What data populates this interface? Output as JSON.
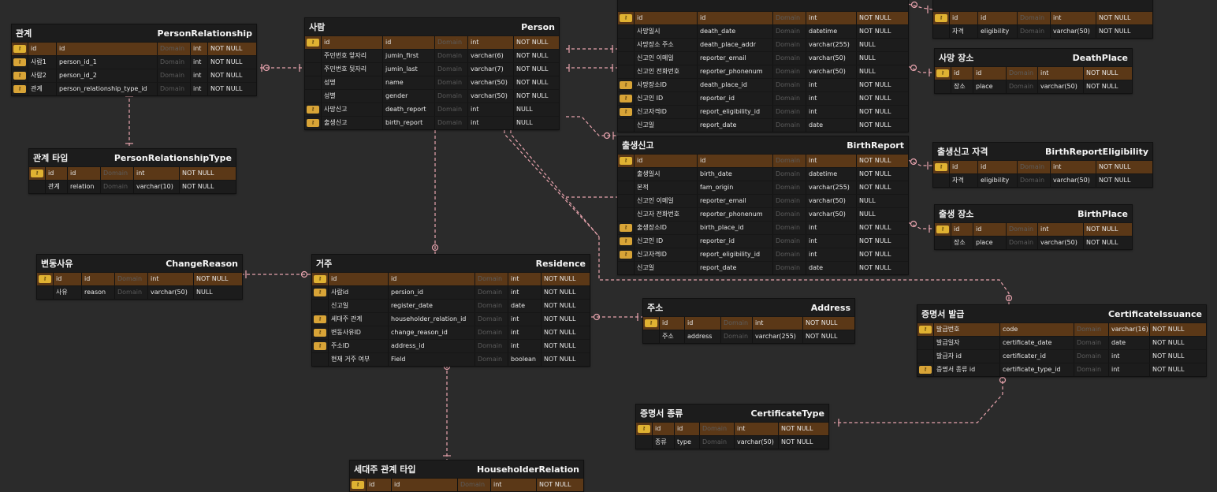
{
  "colors": {
    "canvas": "#2b2b2b",
    "entity_bg": "#1c1c1c",
    "pk_row": "#5b3817",
    "relation_line": "#e7a3ad",
    "key_icon": "#e0b232"
  },
  "key_icon_text": "🔑",
  "entities": [
    {
      "id": "PersonRelationship",
      "logical": "관계",
      "physical": "PersonRelationship",
      "rows": [
        {
          "k": "pk",
          "ln": "id",
          "pn": "id",
          "dm": "Domain",
          "ty": "int",
          "nl": "NOT NULL"
        },
        {
          "k": "fk",
          "ln": "사람1",
          "pn": "person_id_1",
          "dm": "Domain",
          "ty": "int",
          "nl": "NOT NULL"
        },
        {
          "k": "fk",
          "ln": "사람2",
          "pn": "person_id_2",
          "dm": "Domain",
          "ty": "int",
          "nl": "NOT NULL"
        },
        {
          "k": "fk",
          "ln": "관계",
          "pn": "person_relationship_type_id",
          "dm": "Domain",
          "ty": "int",
          "nl": "NOT NULL"
        }
      ]
    },
    {
      "id": "PersonRelationshipType",
      "logical": "관계 타입",
      "physical": "PersonRelationshipType",
      "rows": [
        {
          "k": "pk",
          "ln": "id",
          "pn": "id",
          "dm": "Domain",
          "ty": "int",
          "nl": "NOT NULL"
        },
        {
          "k": "",
          "ln": "관계",
          "pn": "relation",
          "dm": "Domain",
          "ty": "varchar(10)",
          "nl": "NOT NULL"
        }
      ]
    },
    {
      "id": "Person",
      "logical": "사람",
      "physical": "Person",
      "rows": [
        {
          "k": "pk",
          "ln": "id",
          "pn": "id",
          "dm": "Domain",
          "ty": "int",
          "nl": "NOT NULL"
        },
        {
          "k": "",
          "ln": "주민번호 앞자리",
          "pn": "jumin_first",
          "dm": "Domain",
          "ty": "varchar(6)",
          "nl": "NOT NULL"
        },
        {
          "k": "",
          "ln": "주민번호 뒷자리",
          "pn": "jumin_last",
          "dm": "Domain",
          "ty": "varchar(7)",
          "nl": "NOT NULL"
        },
        {
          "k": "",
          "ln": "성명",
          "pn": "name",
          "dm": "Domain",
          "ty": "varchar(50)",
          "nl": "NOT NULL"
        },
        {
          "k": "",
          "ln": "성별",
          "pn": "gender",
          "dm": "Domain",
          "ty": "varchar(50)",
          "nl": "NOT NULL"
        },
        {
          "k": "fk",
          "ln": "사망신고",
          "pn": "death_report",
          "dm": "Domain",
          "ty": "int",
          "nl": "NULL"
        },
        {
          "k": "fk",
          "ln": "출생신고",
          "pn": "birth_report",
          "dm": "Domain",
          "ty": "int",
          "nl": "NULL"
        }
      ]
    },
    {
      "id": "DeathReport",
      "logical": "",
      "physical": "",
      "rows": [
        {
          "k": "pk",
          "ln": "id",
          "pn": "id",
          "dm": "Domain",
          "ty": "int",
          "nl": "NOT NULL"
        },
        {
          "k": "",
          "ln": "사망일시",
          "pn": "death_date",
          "dm": "Domain",
          "ty": "datetime",
          "nl": "NOT NULL"
        },
        {
          "k": "",
          "ln": "사망장소 주소",
          "pn": "death_place_addr",
          "dm": "Domain",
          "ty": "varchar(255)",
          "nl": "NULL"
        },
        {
          "k": "",
          "ln": "신고인 이메일",
          "pn": "reporter_email",
          "dm": "Domain",
          "ty": "varchar(50)",
          "nl": "NULL"
        },
        {
          "k": "",
          "ln": "신고인 전화번호",
          "pn": "reporter_phonenum",
          "dm": "Domain",
          "ty": "varchar(50)",
          "nl": "NULL"
        },
        {
          "k": "fk",
          "ln": "사망장소ID",
          "pn": "death_place_id",
          "dm": "Domain",
          "ty": "int",
          "nl": "NOT NULL"
        },
        {
          "k": "fk",
          "ln": "신고인 ID",
          "pn": "reporter_id",
          "dm": "Domain",
          "ty": "int",
          "nl": "NOT NULL"
        },
        {
          "k": "fk",
          "ln": "신고자격ID",
          "pn": "report_eligibility_id",
          "dm": "Domain",
          "ty": "int",
          "nl": "NOT NULL"
        },
        {
          "k": "",
          "ln": "신고일",
          "pn": "report_date",
          "dm": "Domain",
          "ty": "date",
          "nl": "NOT NULL"
        }
      ]
    },
    {
      "id": "DeathReportEligibility",
      "logical": "",
      "physical": "",
      "rows": [
        {
          "k": "pk",
          "ln": "id",
          "pn": "id",
          "dm": "Domain",
          "ty": "int",
          "nl": "NOT NULL"
        },
        {
          "k": "",
          "ln": "자격",
          "pn": "eligibility",
          "dm": "Domain",
          "ty": "varchar(50)",
          "nl": "NOT NULL"
        }
      ]
    },
    {
      "id": "DeathPlace",
      "logical": "사망 장소",
      "physical": "DeathPlace",
      "rows": [
        {
          "k": "pk",
          "ln": "id",
          "pn": "id",
          "dm": "Domain",
          "ty": "int",
          "nl": "NOT NULL"
        },
        {
          "k": "",
          "ln": "장소",
          "pn": "place",
          "dm": "Domain",
          "ty": "varchar(50)",
          "nl": "NOT NULL"
        }
      ]
    },
    {
      "id": "BirthReport",
      "logical": "출생신고",
      "physical": "BirthReport",
      "rows": [
        {
          "k": "pk",
          "ln": "id",
          "pn": "id",
          "dm": "Domain",
          "ty": "int",
          "nl": "NOT NULL"
        },
        {
          "k": "",
          "ln": "출생일시",
          "pn": "birth_date",
          "dm": "Domain",
          "ty": "datetime",
          "nl": "NOT NULL"
        },
        {
          "k": "",
          "ln": "본적",
          "pn": "fam_origin",
          "dm": "Domain",
          "ty": "varchar(255)",
          "nl": "NOT NULL"
        },
        {
          "k": "",
          "ln": "신고인 이메일",
          "pn": "reporter_email",
          "dm": "Domain",
          "ty": "varchar(50)",
          "nl": "NULL"
        },
        {
          "k": "",
          "ln": "신고자 전화번호",
          "pn": "reporter_phonenum",
          "dm": "Domain",
          "ty": "varchar(50)",
          "nl": "NULL"
        },
        {
          "k": "fk",
          "ln": "출생장소ID",
          "pn": "birth_place_id",
          "dm": "Domain",
          "ty": "int",
          "nl": "NOT NULL"
        },
        {
          "k": "fk",
          "ln": "신고인 ID",
          "pn": "reporter_id",
          "dm": "Domain",
          "ty": "int",
          "nl": "NOT NULL"
        },
        {
          "k": "fk",
          "ln": "신고자격ID",
          "pn": "report_eligibility_id",
          "dm": "Domain",
          "ty": "int",
          "nl": "NOT NULL"
        },
        {
          "k": "",
          "ln": "신고일",
          "pn": "report_date",
          "dm": "Domain",
          "ty": "date",
          "nl": "NOT NULL"
        }
      ]
    },
    {
      "id": "BirthReportEligibility",
      "logical": "출생신고 자격",
      "physical": "BirthReportEligibility",
      "rows": [
        {
          "k": "pk",
          "ln": "id",
          "pn": "id",
          "dm": "Domain",
          "ty": "int",
          "nl": "NOT NULL"
        },
        {
          "k": "",
          "ln": "자격",
          "pn": "eligibility",
          "dm": "Domain",
          "ty": "varchar(50)",
          "nl": "NOT NULL"
        }
      ]
    },
    {
      "id": "BirthPlace",
      "logical": "출생 장소",
      "physical": "BirthPlace",
      "rows": [
        {
          "k": "pk",
          "ln": "id",
          "pn": "id",
          "dm": "Domain",
          "ty": "int",
          "nl": "NOT NULL"
        },
        {
          "k": "",
          "ln": "장소",
          "pn": "place",
          "dm": "Domain",
          "ty": "varchar(50)",
          "nl": "NOT NULL"
        }
      ]
    },
    {
      "id": "ChangeReason",
      "logical": "변동사유",
      "physical": "ChangeReason",
      "rows": [
        {
          "k": "pk",
          "ln": "id",
          "pn": "id",
          "dm": "Domain",
          "ty": "int",
          "nl": "NOT NULL"
        },
        {
          "k": "",
          "ln": "사유",
          "pn": "reason",
          "dm": "Domain",
          "ty": "varchar(50)",
          "nl": "NULL"
        }
      ]
    },
    {
      "id": "Residence",
      "logical": "거주",
      "physical": "Residence",
      "rows": [
        {
          "k": "pk",
          "ln": "id",
          "pn": "id",
          "dm": "Domain",
          "ty": "int",
          "nl": "NOT NULL"
        },
        {
          "k": "fk",
          "ln": "사람id",
          "pn": "persion_id",
          "dm": "Domain",
          "ty": "int",
          "nl": "NOT NULL"
        },
        {
          "k": "",
          "ln": "신고일",
          "pn": "register_date",
          "dm": "Domain",
          "ty": "date",
          "nl": "NOT NULL"
        },
        {
          "k": "fk",
          "ln": "세대주 관계",
          "pn": "householder_relation_id",
          "dm": "Domain",
          "ty": "int",
          "nl": "NOT NULL"
        },
        {
          "k": "fk",
          "ln": "변동사유ID",
          "pn": "change_reason_id",
          "dm": "Domain",
          "ty": "int",
          "nl": "NOT NULL"
        },
        {
          "k": "fk",
          "ln": "주소ID",
          "pn": "address_id",
          "dm": "Domain",
          "ty": "int",
          "nl": "NOT NULL"
        },
        {
          "k": "",
          "ln": "현재 거주 여부",
          "pn": "Field",
          "dm": "Domain",
          "ty": "boolean",
          "nl": "NOT NULL"
        }
      ]
    },
    {
      "id": "Address",
      "logical": "주소",
      "physical": "Address",
      "rows": [
        {
          "k": "pk",
          "ln": "id",
          "pn": "id",
          "dm": "Domain",
          "ty": "int",
          "nl": "NOT NULL"
        },
        {
          "k": "",
          "ln": "주소",
          "pn": "address",
          "dm": "Domain",
          "ty": "varchar(255)",
          "nl": "NOT NULL"
        }
      ]
    },
    {
      "id": "CertificateIssuance",
      "logical": "증명서 발급",
      "physical": "CertificateIssuance",
      "rows": [
        {
          "k": "pk",
          "ln": "발급번호",
          "pn": "code",
          "dm": "Domain",
          "ty": "varchar(16)",
          "nl": "NOT NULL"
        },
        {
          "k": "",
          "ln": "발급일자",
          "pn": "certificate_date",
          "dm": "Domain",
          "ty": "date",
          "nl": "NOT NULL"
        },
        {
          "k": "",
          "ln": "발급자 id",
          "pn": "certificater_id",
          "dm": "Domain",
          "ty": "int",
          "nl": "NOT NULL"
        },
        {
          "k": "fk",
          "ln": "증명서 종류 id",
          "pn": "certificate_type_id",
          "dm": "Domain",
          "ty": "int",
          "nl": "NOT NULL"
        }
      ]
    },
    {
      "id": "CertificateType",
      "logical": "증명서 종류",
      "physical": "CertificateType",
      "rows": [
        {
          "k": "pk",
          "ln": "id",
          "pn": "id",
          "dm": "Domain",
          "ty": "int",
          "nl": "NOT NULL"
        },
        {
          "k": "",
          "ln": "종류",
          "pn": "type",
          "dm": "Domain",
          "ty": "varchar(50)",
          "nl": "NOT NULL"
        }
      ]
    },
    {
      "id": "HouseholderRelation",
      "logical": "세대주 관계 타입",
      "physical": "HouseholderRelation",
      "rows": [
        {
          "k": "pk",
          "ln": "id",
          "pn": "id",
          "dm": "Domain",
          "ty": "int",
          "nl": "NOT NULL"
        }
      ]
    }
  ]
}
